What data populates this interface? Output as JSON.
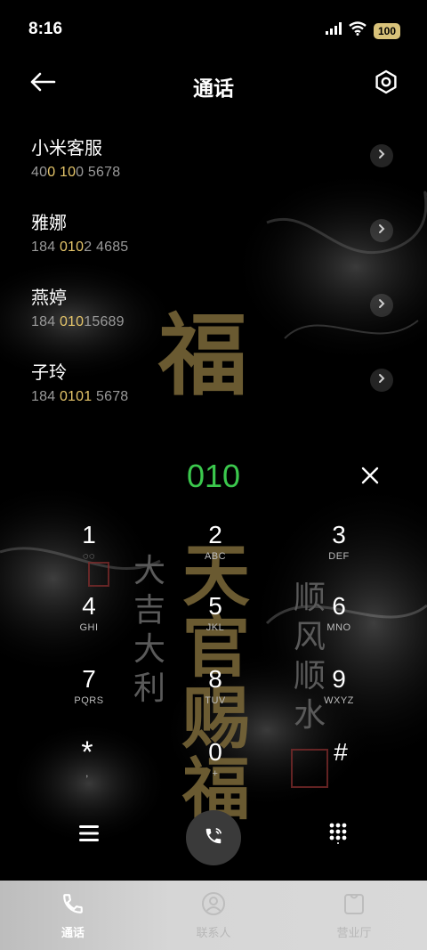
{
  "status_bar": {
    "time": "8:16",
    "battery": "100"
  },
  "header": {
    "title": "通话"
  },
  "contacts": [
    {
      "name": "小米客服",
      "number_parts": [
        "40",
        "0",
        " ",
        "10",
        "0 5678"
      ]
    },
    {
      "name": "雅娜",
      "number_parts": [
        "184 ",
        "010",
        "2 4685"
      ]
    },
    {
      "name": "燕婷",
      "number_parts": [
        "184 ",
        "010",
        "15689"
      ]
    },
    {
      "name": "子玲",
      "number_parts": [
        "184 ",
        "0101",
        " 5678"
      ]
    }
  ],
  "dial": {
    "number": "010"
  },
  "keypad": [
    {
      "digit": "1",
      "letters": "◌◌"
    },
    {
      "digit": "2",
      "letters": "ABC"
    },
    {
      "digit": "3",
      "letters": "DEF"
    },
    {
      "digit": "4",
      "letters": "GHI"
    },
    {
      "digit": "5",
      "letters": "JKL"
    },
    {
      "digit": "6",
      "letters": "MNO"
    },
    {
      "digit": "7",
      "letters": "PQRS"
    },
    {
      "digit": "8",
      "letters": "TUV"
    },
    {
      "digit": "9",
      "letters": "WXYZ"
    },
    {
      "digit": "*",
      "letters": ","
    },
    {
      "digit": "0",
      "letters": "+"
    },
    {
      "digit": "#",
      "letters": ""
    }
  ],
  "bottom_nav": [
    {
      "label": "通话",
      "icon": "phone-icon",
      "active": true
    },
    {
      "label": "联系人",
      "icon": "person-icon",
      "active": false
    },
    {
      "label": "营业厅",
      "icon": "shop-bag-icon",
      "active": false
    }
  ],
  "decor": {
    "big_char_1": "福",
    "big_char_2": "天",
    "big_char_3": "官",
    "big_char_4": "赐",
    "big_char_5": "福",
    "left_col_1": "大吉大利",
    "right_col_1": "顺风顺水"
  },
  "colors": {
    "dial_number": "#3bc84d",
    "highlight": "#e5c56a",
    "battery": "#d8c27a"
  }
}
